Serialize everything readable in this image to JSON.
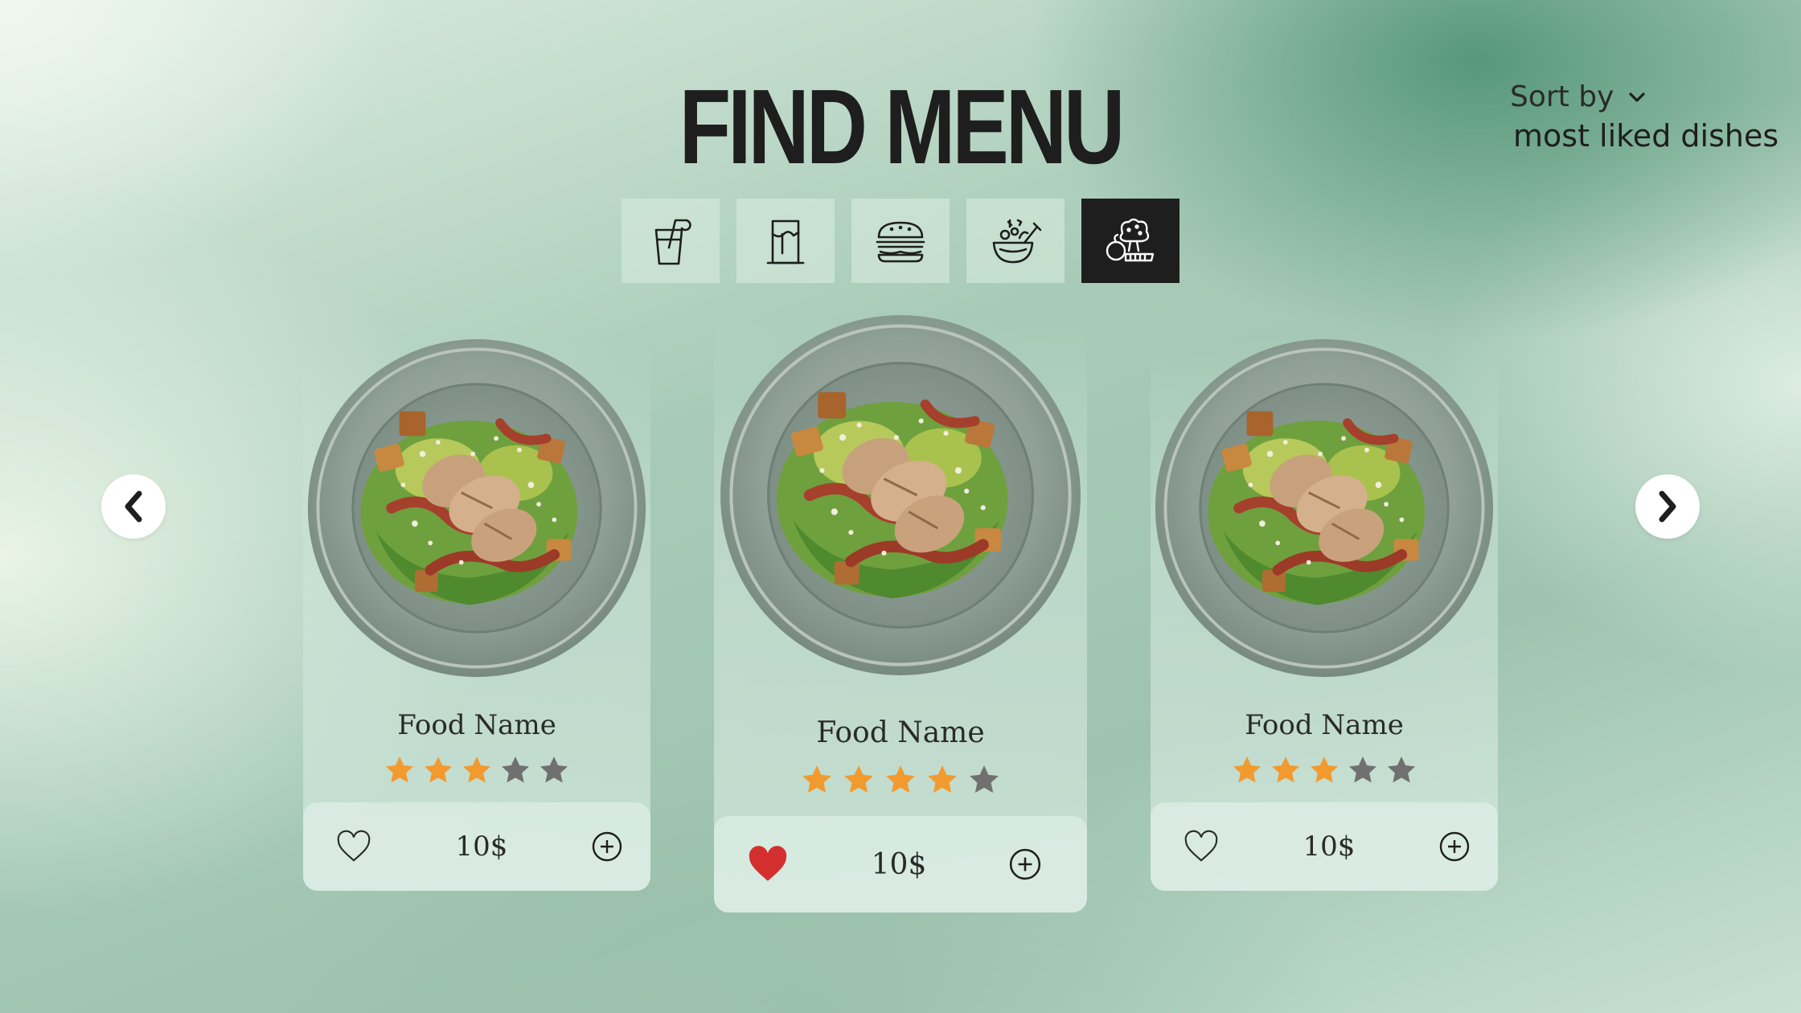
{
  "header": {
    "title": "FIND MENU",
    "sort_label": "Sort by",
    "sort_value": "most liked dishes"
  },
  "categories": [
    {
      "icon": "drink-glass-icon",
      "active": false
    },
    {
      "icon": "milkshake-glass-icon",
      "active": false
    },
    {
      "icon": "burger-icon",
      "active": false
    },
    {
      "icon": "salad-bowl-icon",
      "active": false
    },
    {
      "icon": "vegetables-icon",
      "active": true
    }
  ],
  "cards": [
    {
      "name": "Food Name",
      "rating": 3,
      "max_rating": 5,
      "price": "10$",
      "liked": false
    },
    {
      "name": "Food Name",
      "rating": 4,
      "max_rating": 5,
      "price": "10$",
      "liked": true
    },
    {
      "name": "Food Name",
      "rating": 3,
      "max_rating": 5,
      "price": "10$",
      "liked": false
    }
  ],
  "colors": {
    "star_filled": "#f29a2e",
    "star_empty": "#707070",
    "heart_liked": "#d32f2f",
    "dark": "#1e1e1e"
  }
}
